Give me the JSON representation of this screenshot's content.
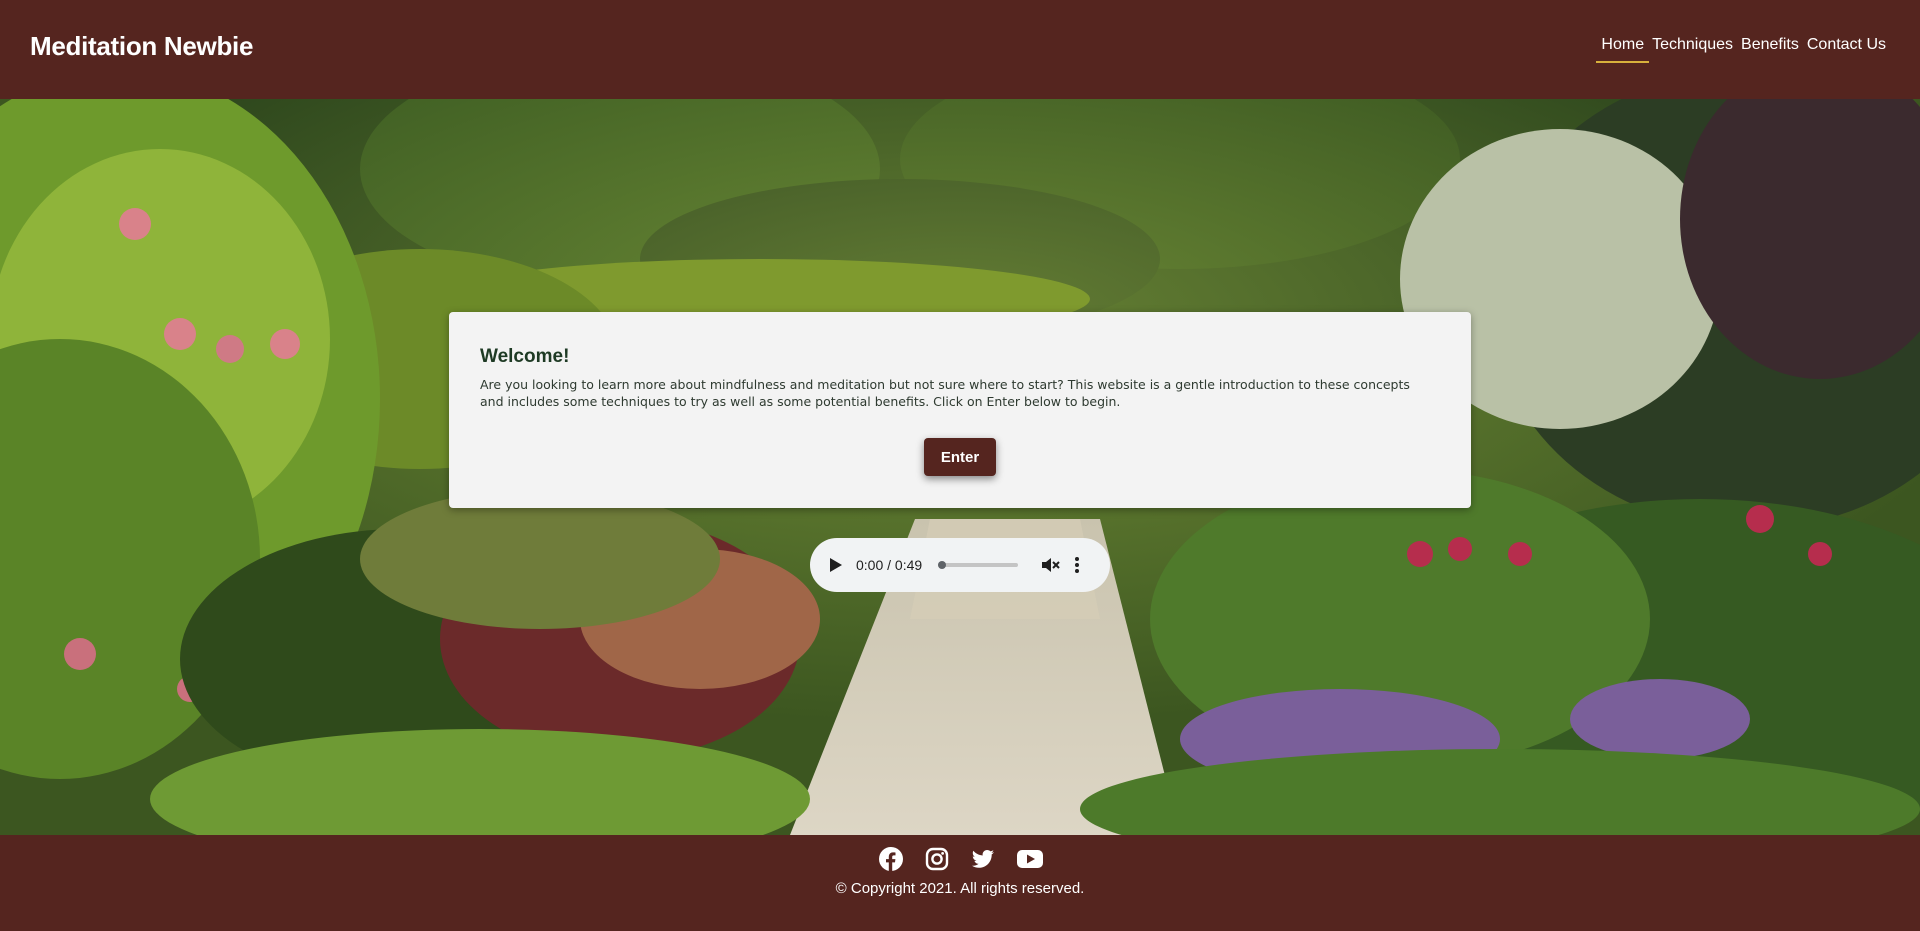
{
  "header": {
    "brand": "Meditation Newbie",
    "nav": [
      {
        "label": "Home",
        "active": true
      },
      {
        "label": "Techniques",
        "active": false
      },
      {
        "label": "Benefits",
        "active": false
      },
      {
        "label": "Contact Us",
        "active": false
      }
    ]
  },
  "welcome": {
    "title": "Welcome!",
    "body": "Are you looking to learn more about mindfulness and meditation but not sure where to start? This website is a gentle introduction to these concepts and includes some techniques to try as well as some potential benefits. Click on Enter below to begin.",
    "button_label": "Enter"
  },
  "audio": {
    "current_time": "0:00",
    "duration": "0:49",
    "time_display": "0:00 / 0:49",
    "muted": true,
    "progress": 0
  },
  "footer": {
    "socials": [
      "facebook-icon",
      "instagram-icon",
      "twitter-icon",
      "youtube-icon"
    ],
    "copyright": "© Copyright 2021. All rights reserved."
  },
  "colors": {
    "brand": "#55251f",
    "nav_underline": "#d8b13c",
    "card_bg": "#f3f3f3",
    "heading": "#1e3a24"
  }
}
